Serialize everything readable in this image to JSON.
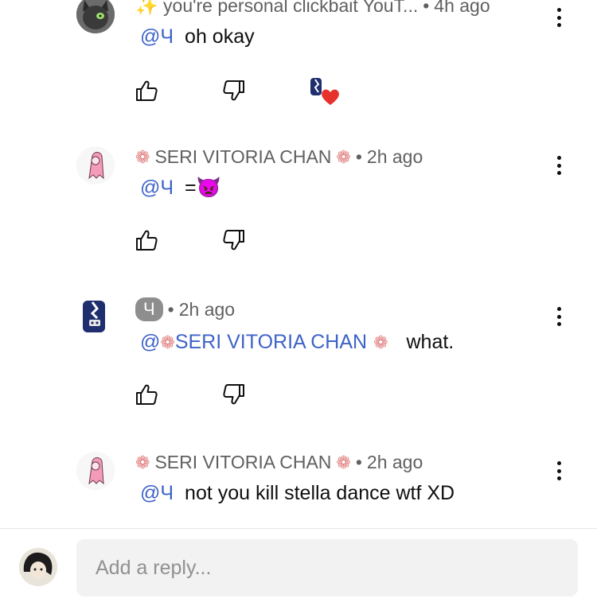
{
  "comments": [
    {
      "author": "✨ you're personal clickbait YouT...",
      "time": "4h ago",
      "mention": "@Ч",
      "text": "oh okay",
      "creator_heart": true
    },
    {
      "author": "SERI VITORIA CHAN",
      "time": "2h ago",
      "mention": "@Ч",
      "text": "=👿"
    },
    {
      "author": "Ч",
      "time": "2h ago",
      "mention": "@",
      "mention_name": "SERI VITORIA CHAN",
      "text": "what."
    },
    {
      "author": "SERI VITORIA CHAN",
      "time": "2h ago",
      "mention": "@Ч",
      "text": "not you kill stella dance wtf XD"
    }
  ],
  "separator": "•",
  "reply": {
    "placeholder": "Add a reply..."
  },
  "icons": {
    "like": "thumbs-up-icon",
    "dislike": "thumbs-down-icon",
    "more": "more-vertical-icon",
    "heart": "creator-heart-icon",
    "flower": "flower-icon"
  },
  "colors": {
    "mention": "#3e63c8",
    "meta": "#606060",
    "heart": "#e5322d",
    "chip": "#8e8e8e"
  }
}
